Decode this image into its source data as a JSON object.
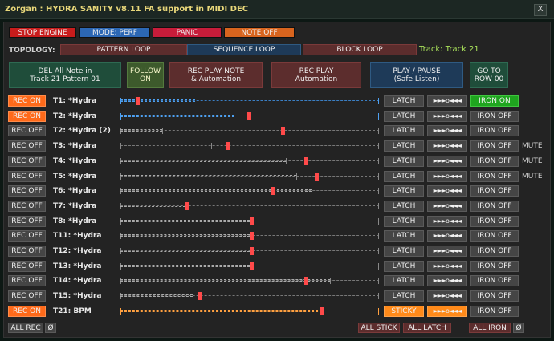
{
  "window": {
    "title": "Zorgan : HYDRA SANITY v8.11 FA support in MIDI DEC",
    "close_label": "X"
  },
  "colors": {
    "rec_on": "#ff6a1a",
    "rec_off": "#454545",
    "iron_on": "#1fa51f",
    "stop_engine": "#c81c1c",
    "mode": "#2c67b4",
    "panic": "#c81c3a",
    "note_off": "#d8641e",
    "sticky": "#ff8a1a",
    "seq_active": "#ff8a1a",
    "marker": "#ff4a4a",
    "lane_blue": "#4ea0f0",
    "lane_orange": "#ffa040",
    "track_label": "#a8e05a"
  },
  "top_bar": {
    "stop_engine": "STOP ENGINE",
    "mode": "MODE: PERF",
    "panic": "PANIC",
    "note_off": "NOTE OFF"
  },
  "topology": {
    "label": "TOPOLOGY:",
    "pattern_loop": "PATTERN LOOP",
    "sequence_loop": "SEQUENCE LOOP",
    "block_loop": "BLOCK LOOP",
    "track_label": "Track: Track 21"
  },
  "actions": {
    "del_line1": "DEL All Note in",
    "del_line2": "Track 21 Pattern 01",
    "follow_line1": "FOLLOW",
    "follow_line2": "ON",
    "rec_note_line1": "REC PLAY NOTE",
    "rec_note_line2": "& Automation",
    "rec_play_line1": "REC PLAY",
    "rec_play_line2": "Automation",
    "play_pause_line1": "PLAY / PAUSE",
    "play_pause_line2": "(Safe Listen)",
    "goto_line1": "GO TO",
    "goto_line2": "ROW 00"
  },
  "tracks": [
    {
      "rec": "REC ON",
      "rec_on": true,
      "name": "T1: *Hydra",
      "latch": "LATCH",
      "seq": "►►►o◄◄◄",
      "iron": "IRON ON",
      "iron_on": true,
      "mute": "",
      "lane": "blue",
      "fill": 0.29,
      "mark": 0.06,
      "extra": []
    },
    {
      "rec": "REC ON",
      "rec_on": true,
      "name": "T2: *Hydra",
      "latch": "LATCH",
      "seq": "►►►o◄◄◄",
      "iron": "IRON OFF",
      "iron_on": false,
      "mute": "",
      "lane": "blue",
      "fill": 0.44,
      "mark": 0.49,
      "extra": [
        0.69
      ]
    },
    {
      "rec": "REC OFF",
      "rec_on": false,
      "name": "T2: *Hydra (2)",
      "latch": "LATCH",
      "seq": "►►►o◄◄◄",
      "iron": "IRON OFF",
      "iron_on": false,
      "mute": "",
      "lane": "grey",
      "fill": 0.16,
      "mark": 0.62,
      "extra": [
        0.16
      ]
    },
    {
      "rec": "REC OFF",
      "rec_on": false,
      "name": "T3: *Hydra",
      "latch": "LATCH",
      "seq": "►►►o◄◄◄",
      "iron": "IRON OFF",
      "iron_on": false,
      "mute": "MUTE",
      "lane": "grey",
      "fill": 0.0,
      "mark": 0.41,
      "extra": [
        0.35
      ]
    },
    {
      "rec": "REC OFF",
      "rec_on": false,
      "name": "T4: *Hydra",
      "latch": "LATCH",
      "seq": "►►►o◄◄◄",
      "iron": "IRON OFF",
      "iron_on": false,
      "mute": "MUTE",
      "lane": "grey",
      "fill": 0.64,
      "mark": 0.71,
      "extra": [
        0.64
      ]
    },
    {
      "rec": "REC OFF",
      "rec_on": false,
      "name": "T5: *Hydra",
      "latch": "LATCH",
      "seq": "►►►o◄◄◄",
      "iron": "IRON OFF",
      "iron_on": false,
      "mute": "MUTE",
      "lane": "grey",
      "fill": 0.68,
      "mark": 0.75,
      "extra": [
        0.68
      ]
    },
    {
      "rec": "REC OFF",
      "rec_on": false,
      "name": "T6: *Hydra",
      "latch": "LATCH",
      "seq": "►►►o◄◄◄",
      "iron": "IRON OFF",
      "iron_on": false,
      "mute": "",
      "lane": "grey",
      "fill": 0.74,
      "mark": 0.58,
      "extra": [
        0.74
      ]
    },
    {
      "rec": "REC OFF",
      "rec_on": false,
      "name": "T7: *Hydra",
      "latch": "LATCH",
      "seq": "►►►o◄◄◄",
      "iron": "IRON OFF",
      "iron_on": false,
      "mute": "",
      "lane": "grey",
      "fill": 0.25,
      "mark": 0.25,
      "extra": []
    },
    {
      "rec": "REC OFF",
      "rec_on": false,
      "name": "T8: *Hydra",
      "latch": "LATCH",
      "seq": "►►►o◄◄◄",
      "iron": "IRON OFF",
      "iron_on": false,
      "mute": "",
      "lane": "grey",
      "fill": 0.5,
      "mark": 0.5,
      "extra": []
    },
    {
      "rec": "REC OFF",
      "rec_on": false,
      "name": "T11: *Hydra",
      "latch": "LATCH",
      "seq": "►►►o◄◄◄",
      "iron": "IRON OFF",
      "iron_on": false,
      "mute": "",
      "lane": "grey",
      "fill": 0.5,
      "mark": 0.5,
      "extra": []
    },
    {
      "rec": "REC OFF",
      "rec_on": false,
      "name": "T12: *Hydra",
      "latch": "LATCH",
      "seq": "►►►o◄◄◄",
      "iron": "IRON OFF",
      "iron_on": false,
      "mute": "",
      "lane": "grey",
      "fill": 0.5,
      "mark": 0.5,
      "extra": []
    },
    {
      "rec": "REC OFF",
      "rec_on": false,
      "name": "T13: *Hydra",
      "latch": "LATCH",
      "seq": "►►►o◄◄◄",
      "iron": "IRON OFF",
      "iron_on": false,
      "mute": "",
      "lane": "grey",
      "fill": 0.5,
      "mark": 0.5,
      "extra": []
    },
    {
      "rec": "REC OFF",
      "rec_on": false,
      "name": "T14: *Hydra",
      "latch": "LATCH",
      "seq": "►►►o◄◄◄",
      "iron": "IRON OFF",
      "iron_on": false,
      "mute": "",
      "lane": "grey",
      "fill": 0.81,
      "mark": 0.71,
      "extra": [
        0.81
      ]
    },
    {
      "rec": "REC OFF",
      "rec_on": false,
      "name": "T15: *Hydra",
      "latch": "LATCH",
      "seq": "►►►o◄◄◄",
      "iron": "IRON OFF",
      "iron_on": false,
      "mute": "",
      "lane": "grey",
      "fill": 0.28,
      "mark": 0.3,
      "extra": [
        0.28
      ]
    },
    {
      "rec": "REC ON",
      "rec_on": true,
      "name": "T21: BPM",
      "latch": "STICKY",
      "seq": "►►►o◄◄◄",
      "iron": "IRON OFF",
      "iron_on": false,
      "mute": "",
      "lane": "orange",
      "fill": 0.78,
      "mark": 0.77,
      "extra": [
        0.8
      ]
    }
  ],
  "bottom": {
    "all_rec": "ALL REC",
    "all_rec_clear": "Ø",
    "all_stick": "ALL STICK",
    "all_latch": "ALL LATCH",
    "all_iron": "ALL IRON",
    "all_iron_clear": "Ø"
  }
}
